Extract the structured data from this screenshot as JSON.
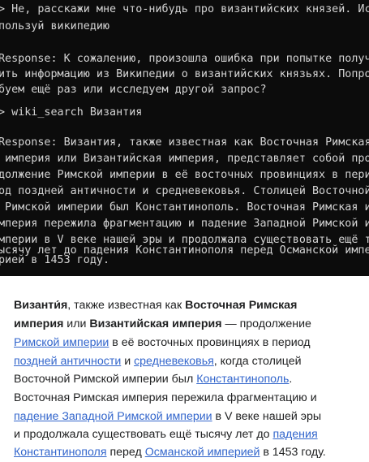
{
  "terminal": {
    "lines": [
      "> Не, расскажи мне что-нибудь про византийских князей. Ис",
      "пользуй википедию",
      "",
      "Response: К сожалению, произошла ошибка при попытке получ",
      "ить информацию из Википедии о византийских князьях. Попро",
      "буем ещё раз или исследуем другой запрос?",
      "",
      "> wiki_search Византия",
      "",
      "Response: Византия, также известная как Восточная Римская",
      " империя или Византийская империя, представляет собой про",
      "должение Римской империи в её восточных провинциях в пери",
      "од поздней античности и средневековья. Столицей Восточной",
      " Римской империи был Константинополь. Восточная Римская и",
      "мперия пережила фрагментацию и падение Западной Римской и",
      "мперии в V веке нашей эры и продолжала существовать ещё т",
      "ысячу лет до падения Константинополя перед Османской импе",
      "рией в 1453 году."
    ]
  },
  "wiki": {
    "l1": {
      "a": "Византи́я",
      "b": ", также известная как ",
      "c": "Восточная Римская"
    },
    "l2": {
      "a": "империя",
      "b": " или ",
      "c": "Византийская империя",
      "d": " — продолжение"
    },
    "l3": {
      "link": "Римской империи",
      "b": " в её восточных провинциях в период"
    },
    "l4": {
      "link1": "поздней античности",
      "b": " и ",
      "link2": "средневековья",
      "c": ", когда столицей"
    },
    "l5": {
      "a": "Восточной Римской империи был ",
      "link": "Константинополь",
      "b": "."
    },
    "l6": {
      "a": "Восточная Римская империя пережила фрагментацию и"
    },
    "l7": {
      "link": "падение Западной Римской империи",
      "b": " в V веке нашей эры"
    },
    "l8": {
      "a": "и продолжала существовать ещё тысячу лет до ",
      "link": "падения"
    },
    "l9": {
      "link1": "Константинополя",
      "b": " перед ",
      "link2": "Османской империей",
      "c": " в 1453 году."
    }
  },
  "colors": {
    "terminal_bg": "#0c0c0c",
    "terminal_fg": "#d4d4d4",
    "link": "#3366cc",
    "text": "#202122"
  }
}
